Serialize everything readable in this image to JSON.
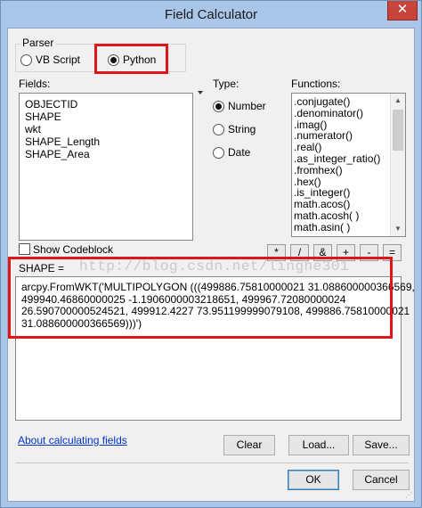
{
  "window": {
    "title": "Field Calculator",
    "close_glyph": "✕"
  },
  "parser": {
    "label": "Parser",
    "options": [
      {
        "label": "VB Script",
        "selected": false
      },
      {
        "label": "Python",
        "selected": true
      }
    ]
  },
  "fields": {
    "label": "Fields:",
    "items": [
      "OBJECTID",
      "SHAPE",
      "wkt",
      "SHAPE_Length",
      "SHAPE_Area"
    ]
  },
  "type": {
    "label": "Type:",
    "options": [
      {
        "label": "Number",
        "selected": true
      },
      {
        "label": "String",
        "selected": false
      },
      {
        "label": "Date",
        "selected": false
      }
    ]
  },
  "functions": {
    "label": "Functions:",
    "items": [
      ".conjugate()",
      ".denominator()",
      ".imag()",
      ".numerator()",
      ".real()",
      ".as_integer_ratio()",
      ".fromhex()",
      ".hex()",
      ".is_integer()",
      "math.acos()",
      "math.acosh( )",
      "math.asin( )"
    ]
  },
  "show_codeblock": {
    "label": "Show Codeblock",
    "checked": false
  },
  "operators": [
    "*",
    "/",
    "&",
    "+",
    "-",
    "="
  ],
  "expression": {
    "label": "SHAPE =",
    "lines": [
      "arcpy.FromWKT('MULTIPOLYGON (((499886.75810000021 31.088600000366569,",
      "499940.46860000025 -1.1906000003218651, 499967.72080000024",
      "26.590700000524521, 499912.4227 73.951199999079108, 499886.75810000021",
      "31.088600000366569)))')"
    ]
  },
  "watermark": "http://blog.csdn.net/linghe301",
  "help_link": "About calculating fields",
  "buttons": {
    "clear": "Clear",
    "load": "Load...",
    "save": "Save...",
    "ok": "OK",
    "cancel": "Cancel"
  },
  "colors": {
    "highlight": "#e0151b",
    "link": "#0033cc",
    "title_bar": "#a9c6e8"
  }
}
